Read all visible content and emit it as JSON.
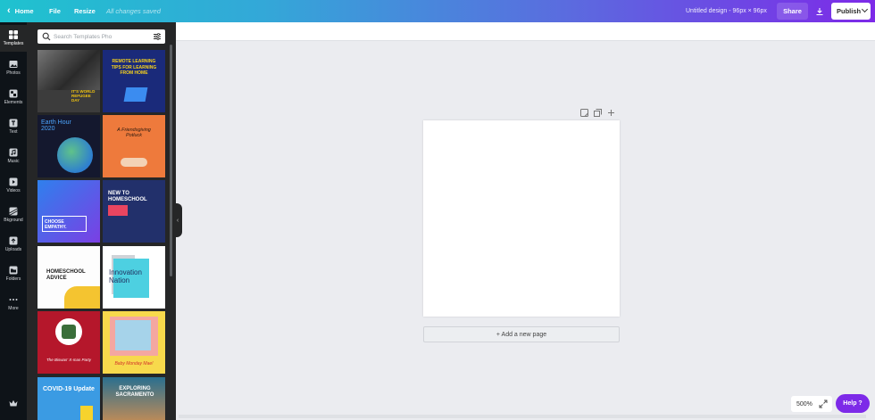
{
  "topbar": {
    "home_label": "Home",
    "file_label": "File",
    "resize_label": "Resize",
    "save_status": "All changes saved",
    "design_title": "Untitled design - 96px × 96px",
    "share_label": "Share",
    "publish_label": "Publish",
    "help_label": "Help ?"
  },
  "rail": [
    {
      "label": "Templates",
      "icon": "templates-icon"
    },
    {
      "label": "Photos",
      "icon": "photos-icon"
    },
    {
      "label": "Elements",
      "icon": "elements-icon"
    },
    {
      "label": "Text",
      "icon": "text-icon"
    },
    {
      "label": "Music",
      "icon": "music-icon"
    },
    {
      "label": "Videos",
      "icon": "videos-icon"
    },
    {
      "label": "Bkground",
      "icon": "background-icon"
    },
    {
      "label": "Uploads",
      "icon": "uploads-icon"
    },
    {
      "label": "Folders",
      "icon": "folders-icon"
    },
    {
      "label": "More",
      "icon": "more-icon"
    }
  ],
  "search": {
    "placeholder": "Search Templates Pho"
  },
  "templates": [
    {
      "text": "IT'S WORLD REFUGEE DAY"
    },
    {
      "text": "REMOTE LEARNING TIPS FOR LEARNING FROM HOME"
    },
    {
      "text": "Earth Hour 2020"
    },
    {
      "text": "A Friendsgiving Potluck"
    },
    {
      "text": "CHOOSE EMPATHY."
    },
    {
      "text": "NEW TO HOMESCHOOL"
    },
    {
      "text": "HOMESCHOOL ADVICE"
    },
    {
      "text": "Innovation Nation"
    },
    {
      "text": "The Biswas' X-mas Party"
    },
    {
      "text": "Baby Monday Mae!"
    },
    {
      "text": "COVID-19 Update"
    },
    {
      "text": "EXPLORING SACRAMENTO"
    }
  ],
  "canvas": {
    "add_page_label": "+ Add a new page",
    "zoom_level": "500%"
  },
  "colors": {
    "accent": "#7d2ae8",
    "topbar_start": "#1fc2cf",
    "panel_bg": "#252627"
  }
}
